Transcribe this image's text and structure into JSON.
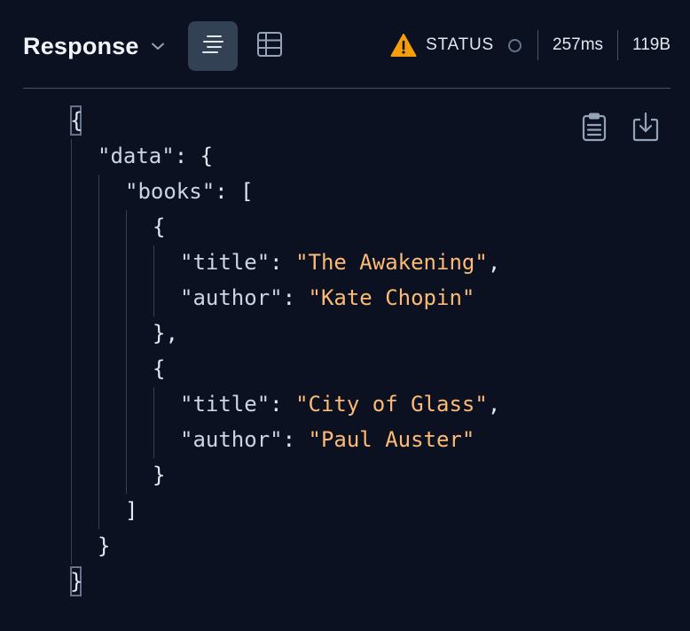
{
  "header": {
    "title": "Response",
    "status_label": "STATUS",
    "time": "257ms",
    "size": "119B"
  },
  "icons": {
    "title_dropdown": "chevron-down-icon",
    "formatted_view": "formatted-view-icon",
    "table_view": "table-view-icon",
    "warning": "warning-icon",
    "status": "status-dot-icon",
    "copy": "clipboard-icon",
    "download": "download-icon"
  },
  "colors": {
    "background": "#0b1120",
    "string": "#fdba74",
    "warning": "#f59e0b",
    "active_toggle": "#334155"
  },
  "json_view": {
    "root_open": "{",
    "data_key": "\"data\"",
    "data_open": "{",
    "books_key": "\"books\"",
    "books_open": "[",
    "title_key": "\"title\"",
    "author_key": "\"author\"",
    "books": [
      {
        "title": "\"The Awakening\"",
        "author": "\"Kate Chopin\""
      },
      {
        "title": "\"City of Glass\"",
        "author": "\"Paul Auster\""
      }
    ],
    "obj_open": "{",
    "obj_close_comma": "},",
    "obj_close": "}",
    "books_close": "]",
    "data_close": "}",
    "root_close": "}"
  }
}
